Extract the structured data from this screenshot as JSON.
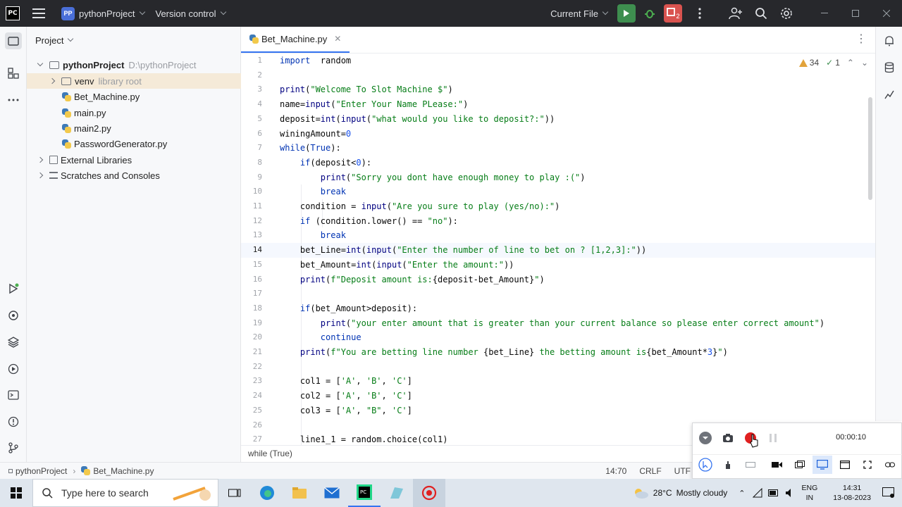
{
  "titlebar": {
    "logo": "PC",
    "project_badge": "PP",
    "project_name": "pythonProject",
    "vcs": "Version control",
    "run_config": "Current File",
    "stop_count": "2"
  },
  "project_panel": {
    "title": "Project",
    "tree": [
      {
        "label": "pythonProject",
        "hint": "D:\\pythonProject"
      },
      {
        "label": "venv",
        "hint": "library root"
      },
      {
        "label": "Bet_Machine.py"
      },
      {
        "label": "main.py"
      },
      {
        "label": "main2.py"
      },
      {
        "label": "PasswordGenerator.py"
      },
      {
        "label": "External Libraries"
      },
      {
        "label": "Scratches and Consoles"
      }
    ]
  },
  "editor": {
    "tab_label": "Bet_Machine.py",
    "warnings": "34",
    "weak_warnings": "1",
    "current_line": 14,
    "line_numbers": [
      "1",
      "2",
      "3",
      "4",
      "5",
      "6",
      "7",
      "8",
      "9",
      "10",
      "11",
      "12",
      "13",
      "14",
      "15",
      "16",
      "17",
      "18",
      "19",
      "20",
      "21",
      "22",
      "23",
      "24",
      "25",
      "26",
      "27"
    ],
    "breadcrumb": "while (True)"
  },
  "statusbar": {
    "project": "pythonProject",
    "file": "Bet_Machine.py",
    "position": "14:70",
    "line_sep": "CRLF",
    "encoding": "UTF"
  },
  "recorder": {
    "timer": "00:00:10"
  },
  "taskbar": {
    "search_placeholder": "Type here to search",
    "weather_temp": "28°C",
    "weather_text": "Mostly cloudy",
    "lang1": "ENG",
    "lang2": "IN",
    "time": "14:31",
    "date": "13-08-2023"
  }
}
